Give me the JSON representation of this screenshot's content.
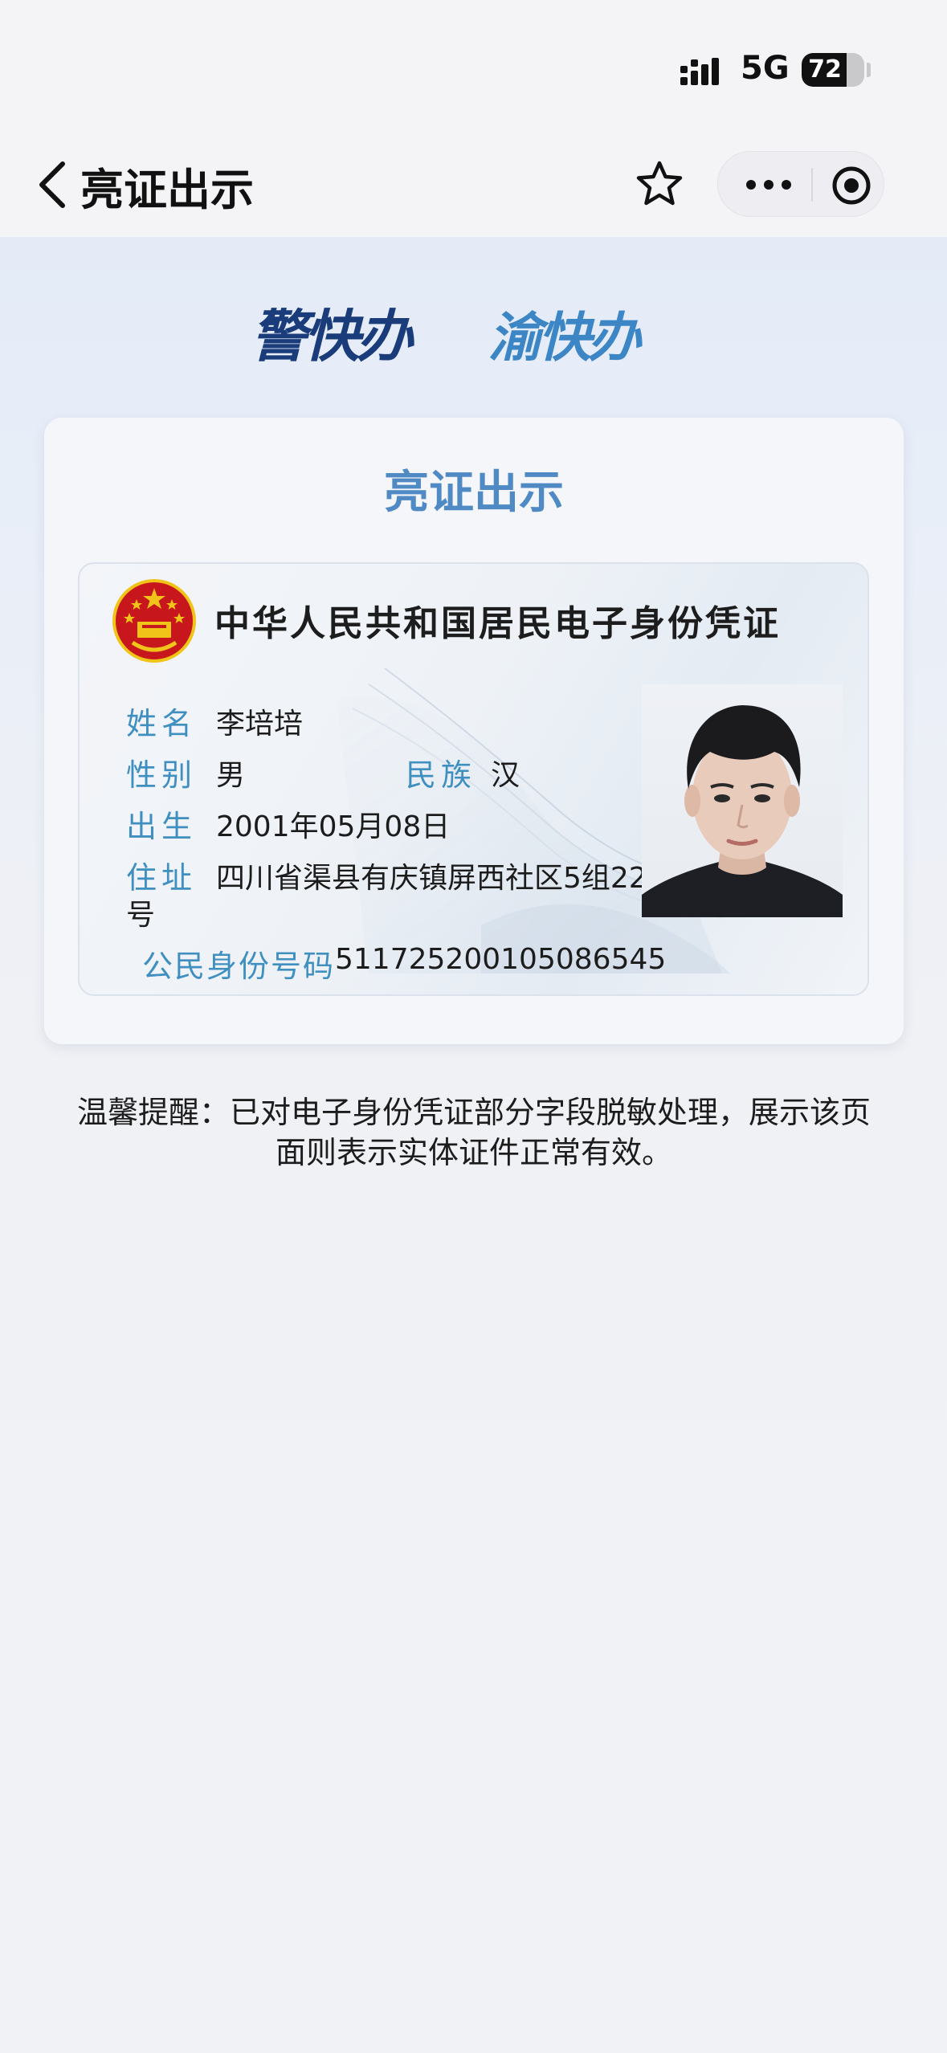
{
  "status_bar": {
    "network": "5G",
    "battery": "72",
    "battery_level_percent": 72
  },
  "nav": {
    "title": "亮证出示"
  },
  "logos": {
    "left": "警快办",
    "right": "渝快办"
  },
  "card": {
    "title": "亮证出示",
    "id_card": {
      "header": "中华人民共和国居民电子身份凭证",
      "name_label": "姓名",
      "name": "李培培",
      "sex_label": "性别",
      "sex": "男",
      "ethnicity_label": "民族",
      "ethnicity": "汉",
      "birth_label": "出生",
      "birth": "2001年05月08日",
      "address_label": "住址",
      "address_line1": "四川省渠县有庆镇屏西社区5组22",
      "address_line2": "号",
      "id_number_label": "公民身份号码",
      "id_number": "511725200105086545"
    }
  },
  "reminder": {
    "line1": "温馨提醒：已对电子身份凭证部分字段脱敏处理，展示该页",
    "line2": "面则表示实体证件正常有效。"
  },
  "icons": {
    "back": "chevron-left-icon",
    "favorite": "star-icon",
    "more": "more-dots-icon",
    "close": "target-icon",
    "emblem": "national-emblem-icon"
  },
  "colors": {
    "label_blue": "#3f8fc0",
    "title_blue": "#4f8ac4",
    "logo_dark": "#1a3c7a",
    "logo_light": "#3d86c6",
    "emblem_red": "#c8161d",
    "emblem_gold": "#f0c419"
  }
}
